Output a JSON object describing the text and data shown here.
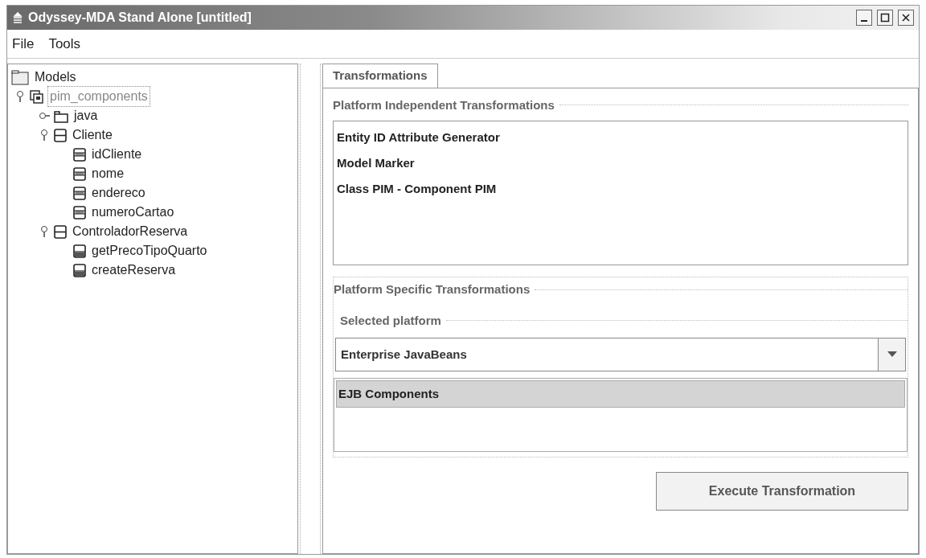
{
  "window": {
    "title": "Odyssey-MDA Stand Alone [untitled]"
  },
  "menu": [
    "File",
    "Tools"
  ],
  "tree": [
    {
      "label": "Models",
      "kind": "root",
      "selected": false,
      "children": [
        {
          "label": "pim_components",
          "kind": "model",
          "expanded": true,
          "selected": true,
          "children": [
            {
              "label": "java",
              "kind": "package",
              "expanded": false,
              "selected": false
            },
            {
              "label": "Cliente",
              "kind": "class",
              "expanded": true,
              "selected": false,
              "children": [
                {
                  "label": "idCliente",
                  "kind": "attribute",
                  "selected": false
                },
                {
                  "label": "nome",
                  "kind": "attribute",
                  "selected": false
                },
                {
                  "label": "endereco",
                  "kind": "attribute",
                  "selected": false
                },
                {
                  "label": "numeroCartao",
                  "kind": "attribute",
                  "selected": false
                }
              ]
            },
            {
              "label": "ControladorReserva",
              "kind": "class",
              "expanded": true,
              "selected": false,
              "children": [
                {
                  "label": "getPrecoTipoQuarto",
                  "kind": "method",
                  "selected": false
                },
                {
                  "label": "createReserva",
                  "kind": "method",
                  "selected": false
                }
              ]
            }
          ]
        }
      ]
    }
  ],
  "tabs": [
    {
      "label": "Transformations",
      "selected": true
    }
  ],
  "independent": {
    "title": "Platform Independent Transformations",
    "items": [
      {
        "label": "Entity ID Attribute Generator",
        "selected": false
      },
      {
        "label": "Model Marker",
        "selected": false
      },
      {
        "label": "Class PIM - Component PIM",
        "selected": false
      }
    ]
  },
  "specific": {
    "title": "Platform Specific Transformations",
    "platform_label": "Selected platform",
    "platform_value": "Enterprise JavaBeans",
    "items": [
      {
        "label": "EJB Components",
        "selected": true
      }
    ]
  },
  "execute_button": "Execute Transformation"
}
